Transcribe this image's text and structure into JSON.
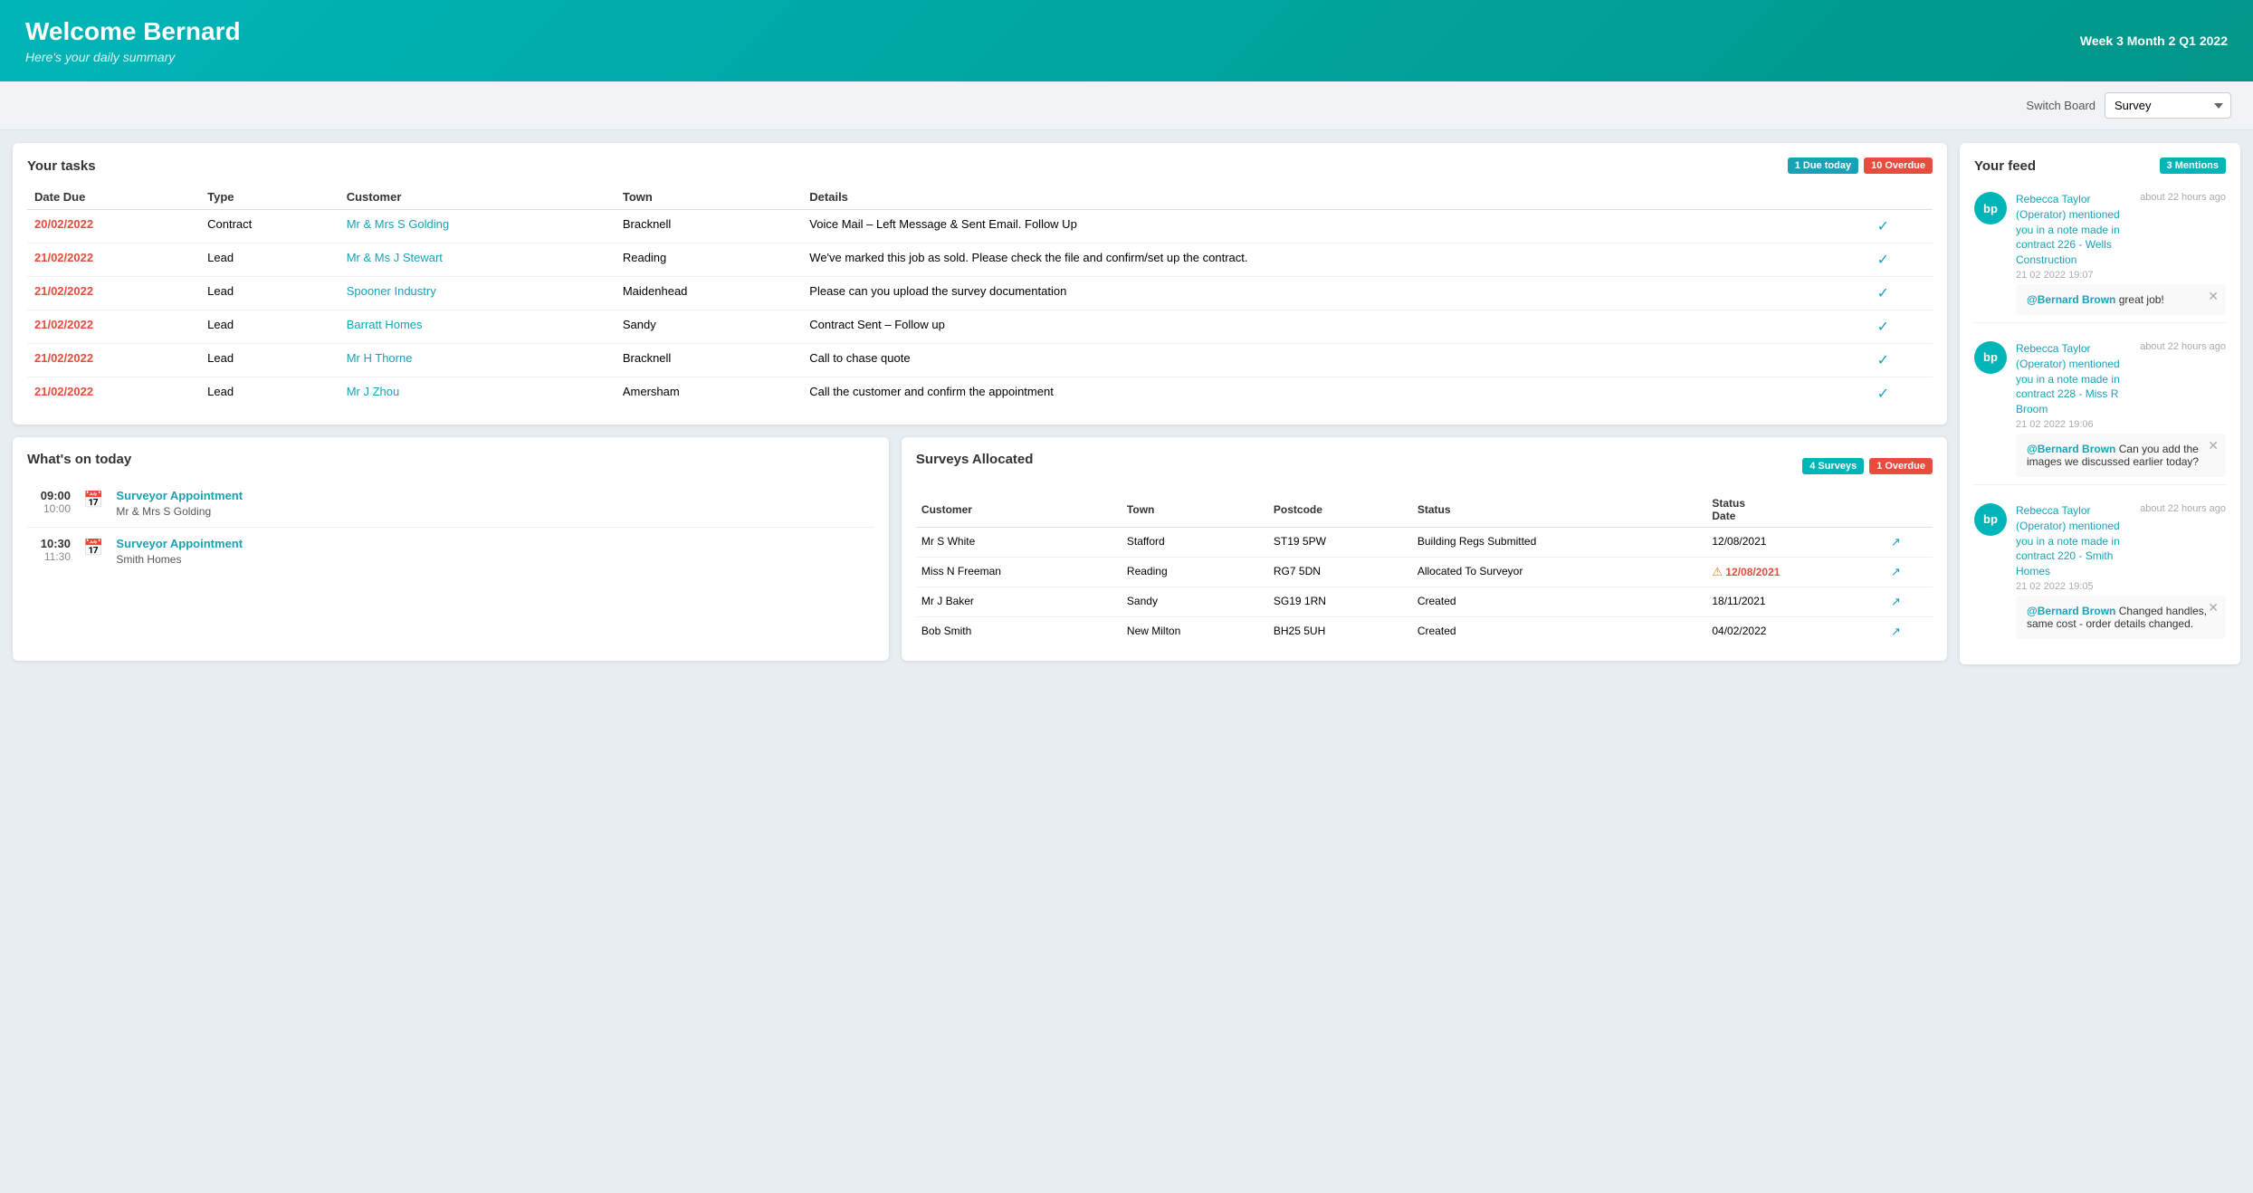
{
  "header": {
    "welcome": "Welcome Bernard",
    "subtitle": "Here's your daily summary",
    "period": "Week 3 Month 2 Q1 2022"
  },
  "toolbar": {
    "switch_board_label": "Switch Board",
    "board_options": [
      "Survey"
    ],
    "board_selected": "Survey"
  },
  "tasks": {
    "title": "Your tasks",
    "badge_due": "1 Due today",
    "badge_overdue": "10 Overdue",
    "columns": [
      "Date Due",
      "Type",
      "Customer",
      "Town",
      "Details"
    ],
    "rows": [
      {
        "date": "20/02/2022",
        "type": "Contract",
        "customer": "Mr & Mrs S Golding",
        "town": "Bracknell",
        "details": "Voice Mail – Left Message & Sent Email. Follow Up"
      },
      {
        "date": "21/02/2022",
        "type": "Lead",
        "customer": "Mr & Ms J Stewart",
        "town": "Reading",
        "details": "We've marked this job as sold. Please check the file and confirm/set up the contract."
      },
      {
        "date": "21/02/2022",
        "type": "Lead",
        "customer": "Spooner Industry",
        "town": "Maidenhead",
        "details": "Please can you upload the survey documentation"
      },
      {
        "date": "21/02/2022",
        "type": "Lead",
        "customer": "Barratt Homes",
        "town": "Sandy",
        "details": "Contract Sent – Follow up"
      },
      {
        "date": "21/02/2022",
        "type": "Lead",
        "customer": "Mr H Thorne",
        "town": "Bracknell",
        "details": "Call to chase quote"
      },
      {
        "date": "21/02/2022",
        "type": "Lead",
        "customer": "Mr J Zhou",
        "town": "Amersham",
        "details": "Call the customer and confirm the appointment"
      }
    ]
  },
  "whats_on": {
    "title": "What's on today",
    "items": [
      {
        "time_start": "09:00",
        "time_end": "10:00",
        "appointment_title": "Surveyor Appointment",
        "customer": "Mr & Mrs S Golding"
      },
      {
        "time_start": "10:30",
        "time_end": "11:30",
        "appointment_title": "Surveyor Appointment",
        "customer": "Smith Homes"
      }
    ]
  },
  "surveys": {
    "title": "Surveys Allocated",
    "badge_surveys": "4 Surveys",
    "badge_overdue": "1 Overdue",
    "columns": [
      "Customer",
      "Town",
      "Postcode",
      "Status",
      "Status Date",
      ""
    ],
    "rows": [
      {
        "customer": "Mr S White",
        "town": "Stafford",
        "postcode": "ST19 5PW",
        "status": "Building Regs Submitted",
        "status_date": "12/08/2021",
        "overdue": false
      },
      {
        "customer": "Miss N Freeman",
        "town": "Reading",
        "postcode": "RG7 5DN",
        "status": "Allocated To Surveyor",
        "status_date": "12/08/2021",
        "overdue": true
      },
      {
        "customer": "Mr J Baker",
        "town": "Sandy",
        "postcode": "SG19 1RN",
        "status": "Created",
        "status_date": "18/11/2021",
        "overdue": false
      },
      {
        "customer": "Bob Smith",
        "town": "New Milton",
        "postcode": "BH25 5UH",
        "status": "Created",
        "status_date": "04/02/2022",
        "overdue": false
      }
    ]
  },
  "feed": {
    "title": "Your feed",
    "badge_mentions": "3 Mentions",
    "items": [
      {
        "avatar_initials": "bp",
        "title": "Rebecca Taylor (Operator) mentioned you in a note made in contract 226 - Wells Construction",
        "timestamp": "about 22 hours ago",
        "date": "21 02 2022 19:07",
        "reply": "@Bernard Brown great job!"
      },
      {
        "avatar_initials": "bp",
        "title": "Rebecca Taylor (Operator) mentioned you in a note made in contract 228 - Miss R Broom",
        "timestamp": "about 22 hours ago",
        "date": "21 02 2022 19:06",
        "reply": "@Bernard Brown Can you add the images we discussed earlier today?"
      },
      {
        "avatar_initials": "bp",
        "title": "Rebecca Taylor (Operator) mentioned you in a note made in contract 220 - Smith Homes",
        "timestamp": "about 22 hours ago",
        "date": "21 02 2022 19:05",
        "reply": "@Bernard Brown Changed handles, same cost - order details changed."
      }
    ]
  }
}
